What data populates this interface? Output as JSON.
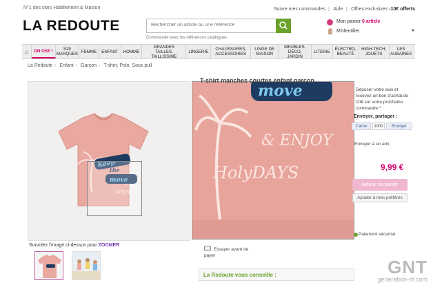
{
  "header": {
    "tagline": "N°1 des sites Habillement & Maison",
    "links": [
      "Suivre mes commandes",
      "Aide",
      "Offres exclusives"
    ],
    "offer_bold": "-10€ offerts",
    "logo": "LA REDOUTE",
    "search_placeholder": "Rechercher un article ou une référence",
    "search_hint": "Commander avec les références catalogues",
    "cart_label": "Mon panier",
    "cart_count": "0 article",
    "identify_label": "M'identifier"
  },
  "nav": {
    "items": [
      {
        "label": "ON OSE !",
        "promo": true
      },
      {
        "label": "S29 MARQUES"
      },
      {
        "label": "FEMME"
      },
      {
        "label": "ENFANT"
      },
      {
        "label": "HOMME"
      },
      {
        "label": "GRANDES TAILLES, TAILLISSIME"
      },
      {
        "label": "LINGERIE"
      },
      {
        "label": "CHAUSSURES, ACCESSOIRES"
      },
      {
        "label": "LINGE DE MAISON"
      },
      {
        "label": "MEUBLES, DÉCO, JARDIN"
      },
      {
        "label": "LITERIE"
      },
      {
        "label": "ÉLECTRO, BEAUTÉ"
      },
      {
        "label": "HIGH-TECH, JOUETS"
      },
      {
        "label": "LES AUBAINES"
      }
    ]
  },
  "breadcrumb": [
    "La Redoute",
    "Enfant",
    "Garçon",
    "T-shirt, Polo, Sous pull"
  ],
  "product": {
    "title": "T-shirt manches courtes enfant garçon",
    "shirt_print_1": "Keep",
    "shirt_print_2": "the",
    "shirt_print_3": "move",
    "zoom_text_1": "move",
    "zoom_text_2": "& ENJOY",
    "zoom_text_3": "HolyDAYS",
    "zoom_hint_prefix": "Survolez l'image ci-dessus pour",
    "zoom_hint_bold": "ZOOMER",
    "review_text": "Déposer votre avis et recevez un bon d'achat de 10€ sur votre prochaine commande.*",
    "share_label": "Envoyer, partager :",
    "fb_like": "J'aime",
    "fb_count": "1000",
    "send_label": "Envoyer",
    "friend_label": "Envoyer à un ami",
    "price": "9,99 €",
    "add_cart": "Ajouter au panier",
    "add_fav": "Ajouter à mes préférés",
    "payment": "Paiement sécurisé",
    "try_label": "Essayer avant de payer",
    "advice_title": "La Redoute vous conseille :"
  },
  "watermark": {
    "brand": "GNT",
    "site": "generation-nt.com"
  }
}
